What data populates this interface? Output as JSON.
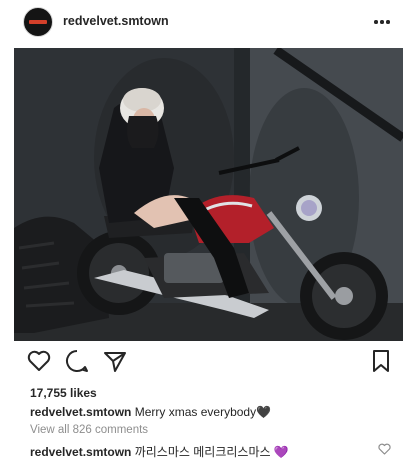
{
  "post": {
    "username": "redvelvet.smtown",
    "more_icon": "more-dots-icon",
    "image_icon": "photo-icon"
  },
  "actions": {
    "like_icon": "heart-icon",
    "comment_icon": "comment-bubble-icon",
    "share_icon": "paper-plane-icon",
    "save_icon": "bookmark-icon"
  },
  "likes": "17,755 likes",
  "caption": {
    "username": "redvelvet.smtown",
    "text": "Merry xmas everybody",
    "emoji": "🖤"
  },
  "view_comments": "View all 826 comments",
  "comment": {
    "username": "redvelvet.smtown",
    "text": "까리스마스 메리크리스마스",
    "emoji": "💜",
    "like_icon": "small-heart-icon"
  },
  "colors": {
    "text": "#262626",
    "muted": "#8e8e8e",
    "motorcycle_red": "#b3202a",
    "purple_heart": "#9b59d0"
  }
}
